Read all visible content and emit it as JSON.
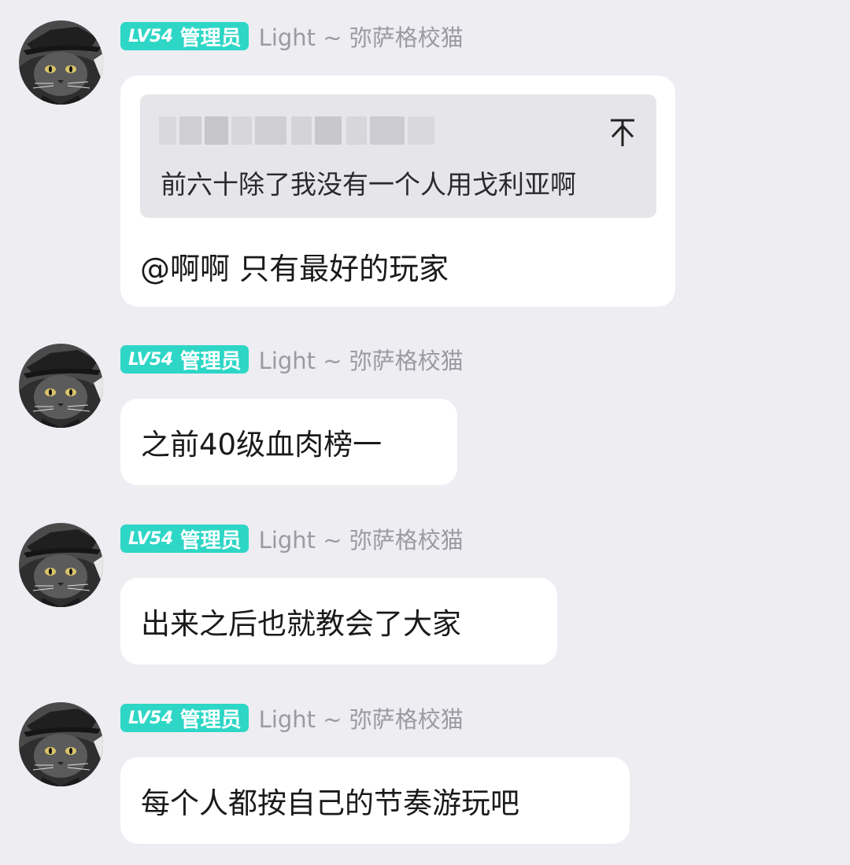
{
  "colors": {
    "background": "#ededf2",
    "bubble": "#ffffff",
    "badge": "#2ed6c6",
    "username": "#9a9aa3",
    "quote_background": "#e6e6ea"
  },
  "sender": {
    "level_badge": "LV54",
    "role_badge": "管理员",
    "username": "Light ~ 弥萨格校猫",
    "avatar_icon": "black-cat-with-hat-avatar"
  },
  "messages": [
    {
      "quote": {
        "icon": "jump-to-top-icon",
        "text": "前六十除了我没有一个人用戈利亚啊"
      },
      "text": "@啊啊 只有最好的玩家"
    },
    {
      "text": "之前40级血肉榜一"
    },
    {
      "text": "出来之后也就教会了大家"
    },
    {
      "text": "每个人都按自己的节奏游玩吧"
    }
  ]
}
